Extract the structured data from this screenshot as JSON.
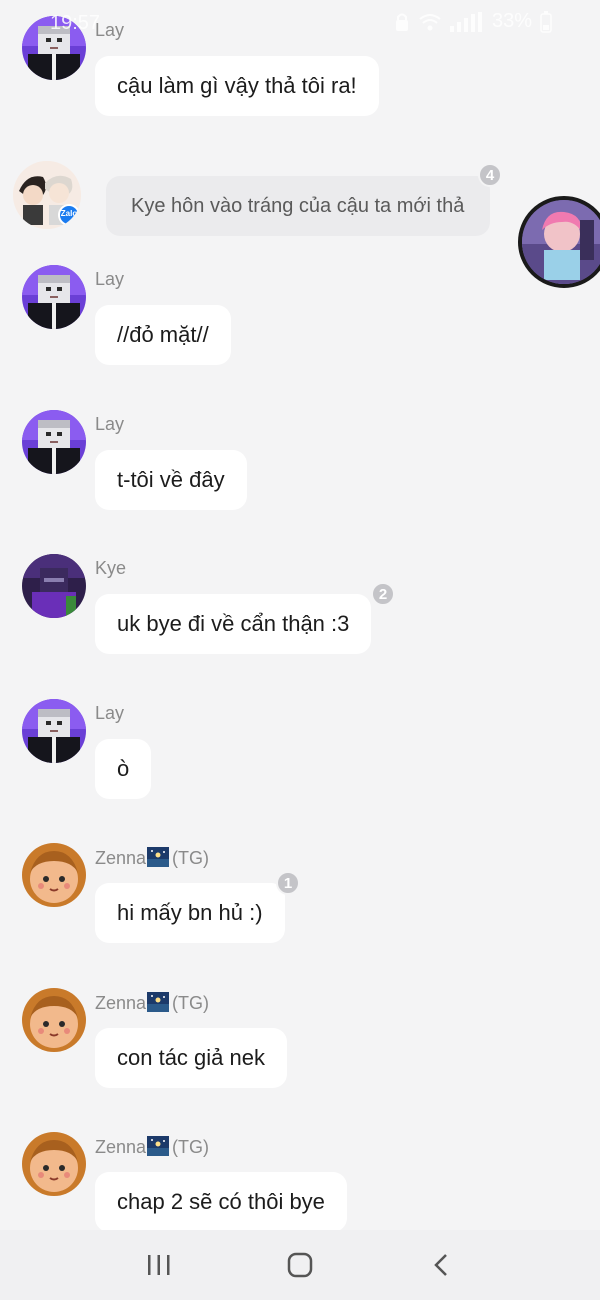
{
  "status_bar": {
    "time": "19:57",
    "battery": "33%",
    "icons": [
      "lock-icon",
      "wifi-icon",
      "signal-icon",
      "battery-icon"
    ]
  },
  "messages": [
    {
      "sender": "Lay",
      "text": "cậu làm gì vậy thả tôi ra!",
      "avatar": "lay-avatar"
    },
    {
      "sender": "Lay",
      "text": "//đỏ mặt//",
      "avatar": "lay-avatar"
    },
    {
      "sender": "Lay",
      "text": "t-tôi về đây",
      "avatar": "lay-avatar"
    },
    {
      "sender": "Kye",
      "text": "uk  bye đi về cẩn thận :3",
      "avatar": "kye-avatar",
      "reactions": "2"
    },
    {
      "sender": "Lay",
      "text": "ò",
      "avatar": "lay-avatar"
    },
    {
      "sender": "Zenna",
      "sender_tag": "(TG)",
      "text": "hi mấy bn hủ :)",
      "avatar": "zenna-avatar",
      "reactions": "1"
    },
    {
      "sender": "Zenna",
      "sender_tag": "(TG)",
      "text": "con tác giả nek",
      "avatar": "zenna-avatar"
    },
    {
      "sender": "Zenna",
      "sender_tag": "(TG)",
      "text": "chap 2 sẽ có thôi bye",
      "avatar": "zenna-avatar"
    }
  ],
  "system_message": {
    "text": "Kye hôn vào tráng của cậu ta mới thả",
    "reactions": "4",
    "avatar_badge": "Zalo"
  },
  "colors": {
    "background": "#f4f4f5",
    "bubble": "#ffffff",
    "system_bubble": "#ebebed",
    "sender_name": "#8a8a8a",
    "badge": "#c4c4c8"
  },
  "nav": {
    "recents": "recents-icon",
    "home": "home-icon",
    "back": "back-icon"
  }
}
